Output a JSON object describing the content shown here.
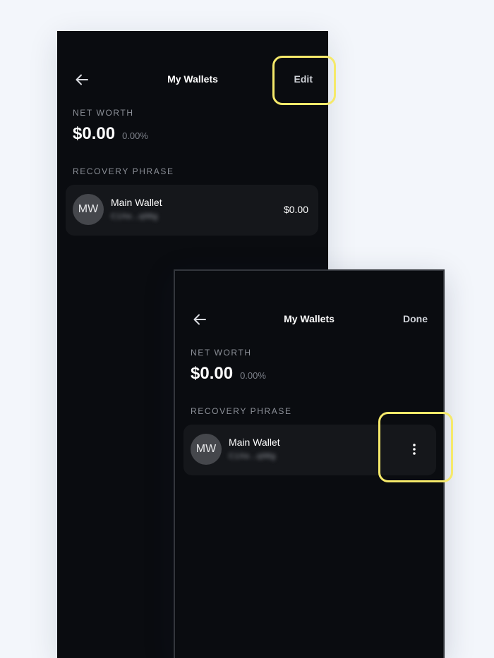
{
  "screens": [
    {
      "header": {
        "title": "My Wallets",
        "action_label": "Edit"
      },
      "net_worth": {
        "label": "NET WORTH",
        "value": "$0.00",
        "change": "0.00%"
      },
      "recovery_phrase": {
        "label": "RECOVERY PHRASE"
      },
      "wallet": {
        "initials": "MW",
        "name": "Main Wallet",
        "address_masked": "C1Xe...q98g",
        "balance": "$0.00"
      }
    },
    {
      "header": {
        "title": "My Wallets",
        "action_label": "Done"
      },
      "net_worth": {
        "label": "NET WORTH",
        "value": "$0.00",
        "change": "0.00%"
      },
      "recovery_phrase": {
        "label": "RECOVERY PHRASE"
      },
      "wallet": {
        "initials": "MW",
        "name": "Main Wallet",
        "address_masked": "C1Xe...q98g"
      }
    }
  ],
  "icons": {
    "back": "arrow-left-icon",
    "more": "more-vertical-icon"
  },
  "colors": {
    "background": "#0a0c10",
    "card": "#15171b",
    "highlight": "#f5e96a",
    "page": "#f3f6fb"
  }
}
